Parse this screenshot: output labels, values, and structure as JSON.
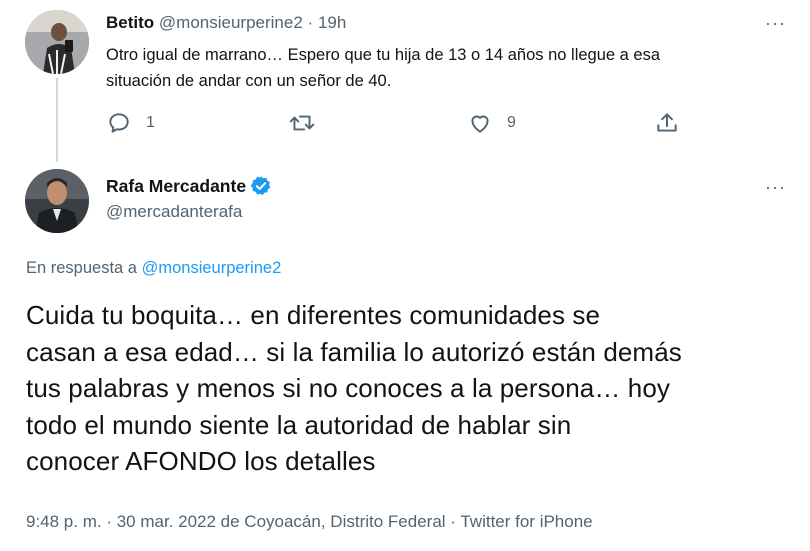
{
  "reply_tweet": {
    "display_name": "Betito",
    "handle": "@monsieurperine2",
    "separator": "·",
    "time": "19h",
    "more_label": "···",
    "text_line1": "Otro igual de marrano… Espero que tu hija de 13 o 14 años no llegue a esa",
    "text_line2": "situación de andar con un señor de 40.",
    "reply_count": "1",
    "retweet_count": "",
    "like_count": "9"
  },
  "main_tweet": {
    "display_name": "Rafa Mercadante",
    "handle": "@mercadanterafa",
    "verified": true,
    "more_label": "···",
    "in_reply_prefix": "En respuesta a",
    "in_reply_handle": "@monsieurperine2",
    "text_lines": [
      "Cuida tu boquita… en diferentes comunidades se",
      "casan a esa edad… si la familia lo autorizó están demás",
      "tus palabras y menos si no conoces a la persona… hoy",
      "todo el mundo siente la autoridad de hablar sin",
      "conocer AFONDO los detalles"
    ],
    "meta": "9:48 p. m. · 30 mar. 2022 de Coyoacán, Distrito Federal · Twitter for iPhone"
  },
  "colors": {
    "accent": "#1d9bf0",
    "muted": "#536471",
    "text": "#0f1419",
    "thread_line": "#cfd9de"
  },
  "icons": {
    "reply": "comment-icon",
    "retweet": "retweet-icon",
    "like": "heart-icon",
    "share": "share-icon",
    "verified": "verified-badge-icon",
    "more": "more-options-icon"
  }
}
